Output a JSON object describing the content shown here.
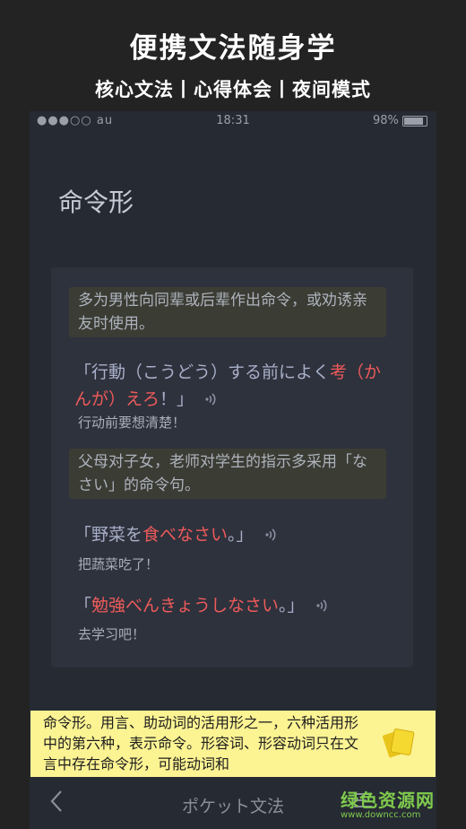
{
  "promo": {
    "title": "便携文法随身学",
    "subtitle": "核心文法丨心得体会丨夜间模式"
  },
  "status": {
    "carrier": "●●●○○ au",
    "time": "18:31",
    "battery": "98%"
  },
  "page": {
    "title": "命令形"
  },
  "lesson": {
    "note1": "多为男性向同辈或后辈作出命令，或劝诱亲友时使用。",
    "ex1": {
      "pre": "「行動（こうどう）する前によく",
      "hl": "考（かんが）えろ",
      "post": "！」",
      "zh": "行动前要想清楚！"
    },
    "note2": "父母对子女，老师对学生的指示多采用「なさい」的命令句。",
    "ex2": {
      "pre": "「野菜を",
      "hl": "食べなさい",
      "post": "。」",
      "zh": "把蔬菜吃了！"
    },
    "ex3": {
      "pre": "「",
      "hl": "勉強べんきょうしなさい",
      "post": "。」",
      "zh": "去学习吧！"
    }
  },
  "definition": {
    "text": "命令形。用言、助动词的活用形之一，六种活用形中的第六种，表示命令。形容词、形容动词只在文言中存在命令形，可能动词和"
  },
  "bottom": {
    "title": "ポケット文法"
  },
  "watermark": {
    "main": "绿色资源网",
    "sub": "www.downcc.com"
  },
  "colors": {
    "highlight": "#ee5a5a",
    "bubble": "#fcf393",
    "watermark": "#7fcb4d"
  }
}
